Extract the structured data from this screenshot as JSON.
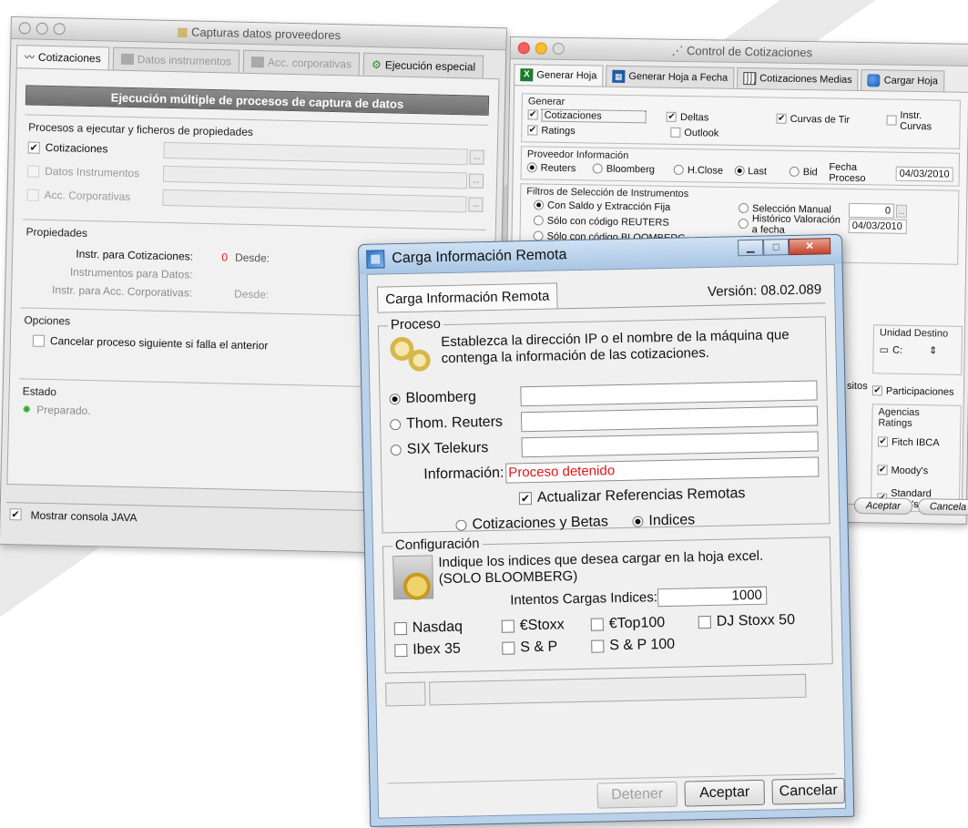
{
  "win1": {
    "title": "Capturas datos proveedores",
    "tabs": [
      "Cotizaciones",
      "Datos instrumentos",
      "Acc. corporativas",
      "Ejecución especial"
    ],
    "banner": "Ejecución múltiple de procesos de captura de datos",
    "procesos_title": "Procesos a ejecutar y ficheros de propiedades",
    "procesos": [
      {
        "label": "Cotizaciones",
        "checked": "✔"
      },
      {
        "label": "Datos Instrumentos",
        "checked": ""
      },
      {
        "label": "Acc. Corporativas",
        "checked": ""
      }
    ],
    "dots": "...",
    "propiedades_title": "Propiedades",
    "props": [
      {
        "label": "Instr. para Cotizaciones:",
        "value": "0",
        "desde": "Desde:"
      },
      {
        "label": "Instrumentos para Datos:",
        "value": "",
        "desde": ""
      },
      {
        "label": "Instr. para Acc. Corporativas:",
        "value": "",
        "desde": "Desde:"
      }
    ],
    "opciones_title": "Opciones",
    "opcion_cancelar": "Cancelar proceso siguiente si falla el anterior",
    "estado_title": "Estado",
    "estado_value": "Preparado.",
    "mostrar_consola": "Mostrar consola JAVA",
    "mostrar_check": "✔"
  },
  "win2": {
    "title": "Control de Cotizaciones",
    "tabs": [
      "Generar Hoja",
      "Generar Hoja a Fecha",
      "Cotizaciones Medias",
      "Cargar Hoja"
    ],
    "generar_title": "Generar",
    "gen_cotizaciones": "Cotizaciones",
    "gen_deltas": "Deltas",
    "gen_curvas": "Curvas de Tir",
    "gen_instr_curvas": "Instr. Curvas",
    "gen_ratings": "Ratings",
    "gen_outlook": "Outlook",
    "check": "✔",
    "proveedor_title": "Proveedor Información",
    "prov_reuters": "Reuters",
    "prov_bloomberg": "Bloomberg",
    "prov_hclose": "H.Close",
    "prov_last": "Last",
    "prov_bid": "Bid",
    "fecha_proceso_label": "Fecha Proceso",
    "fecha_proceso": "04/03/2010",
    "filtros_title": "Filtros de Selección de Instrumentos",
    "filtro_saldo": "Con Saldo y Extracción Fija",
    "filtro_reuters": "Sólo con código REUTERS",
    "filtro_bloomberg": "Sólo con código BLOOMBERG",
    "filtro_manual": "Selección Manual",
    "filtro_historico": "Histórico Valoración a fecha",
    "filtro_num": "0",
    "filtro_dots": "...",
    "filtro_fecha": "04/03/2010",
    "unidad_title": "Unidad Destino",
    "unidad_value": "C:",
    "sitos": "sitos",
    "participaciones": "Participaciones",
    "agencias_title": "Agencias Ratings",
    "agencias": [
      "Fitch IBCA",
      "Moody's",
      "Standard Poor's"
    ],
    "aceptar": "Aceptar",
    "cancelar": "Cancela"
  },
  "win3": {
    "title": "Carga Información Remota",
    "min": "▁",
    "max": "□",
    "close": "✕",
    "tab": "Carga Información Remota",
    "version": "Versión: 08.02.089",
    "proceso_title": "Proceso",
    "proceso_text": "Establezca la dirección IP o el nombre de la máquina que contenga la información de las cotizaciones.",
    "fuentes": [
      {
        "label": "Bloomberg",
        "selected": true
      },
      {
        "label": "Thom. Reuters",
        "selected": false
      },
      {
        "label": "SIX Telekurs",
        "selected": false
      }
    ],
    "informacion_label": "Información:",
    "informacion_value": "Proceso detenido",
    "actualizar": "Actualizar Referencias Remotas",
    "actualizar_check": "✔",
    "modo_cotizaciones": "Cotizaciones y Betas",
    "modo_indices": "Indices",
    "config_title": "Configuración",
    "config_text1": "Indique los indices que desea cargar en la hoja excel.",
    "config_text2": "(SOLO BLOOMBERG)",
    "intentos_label": "Intentos Cargas Indices:",
    "intentos_value": "1000",
    "indices_row1": [
      "Nasdaq",
      "€Stoxx",
      "€Top100",
      "DJ Stoxx 50"
    ],
    "indices_row2": [
      "Ibex 35",
      "S & P",
      "S & P 100"
    ],
    "btn_detener": "Detener",
    "btn_aceptar": "Aceptar",
    "btn_cancelar": "Cancelar"
  }
}
